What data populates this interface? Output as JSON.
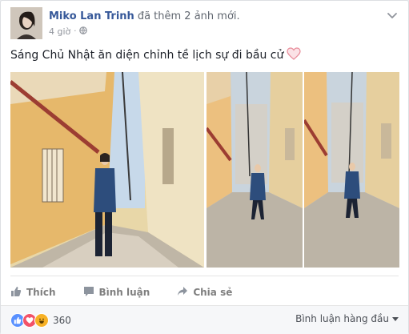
{
  "post": {
    "author": "Miko Lan Trinh",
    "action": "đã thêm 2 ảnh mới.",
    "time": "4 giờ",
    "separator": "·",
    "caption": "Sáng Chủ Nhật ăn diện chỉnh tề lịch sự đi bầu cử",
    "icons": {
      "privacy": "globe-icon",
      "options": "chevron-down-icon",
      "emoji": "heart-icon"
    }
  },
  "actions": {
    "like": "Thích",
    "comment": "Bình luận",
    "share": "Chia sẻ"
  },
  "reactions": {
    "count": "360",
    "types": [
      "like",
      "love",
      "haha"
    ],
    "colors": {
      "like": "#5890ff",
      "love": "#f25268",
      "haha": "#f7b125"
    }
  },
  "comments": {
    "sort_label": "Bình luận hàng đầu"
  }
}
